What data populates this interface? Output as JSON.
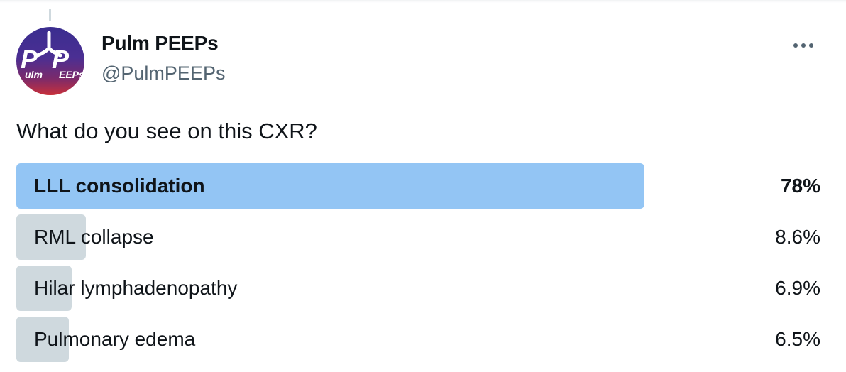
{
  "account": {
    "display_name": "Pulm PEEPs",
    "handle": "@PulmPEEPs",
    "avatar_icon": "pulm-peeps-logo",
    "avatar_text": "Pulm PEEPs"
  },
  "more_icon": "more-dots-icon",
  "tweet": {
    "text": "What do you see on this CXR?"
  },
  "poll": {
    "colors": {
      "winner_bar": "#93c5f4",
      "other_bar": "#cfd9de"
    },
    "options": [
      {
        "label": "LLL consolidation",
        "percent_text": "78%",
        "percent": 78,
        "winner": true
      },
      {
        "label": "RML collapse",
        "percent_text": "8.6%",
        "percent": 8.6,
        "winner": false
      },
      {
        "label": "Hilar lymphadenopathy",
        "percent_text": "6.9%",
        "percent": 6.9,
        "winner": false
      },
      {
        "label": "Pulmonary edema",
        "percent_text": "6.5%",
        "percent": 6.5,
        "winner": false
      }
    ]
  }
}
